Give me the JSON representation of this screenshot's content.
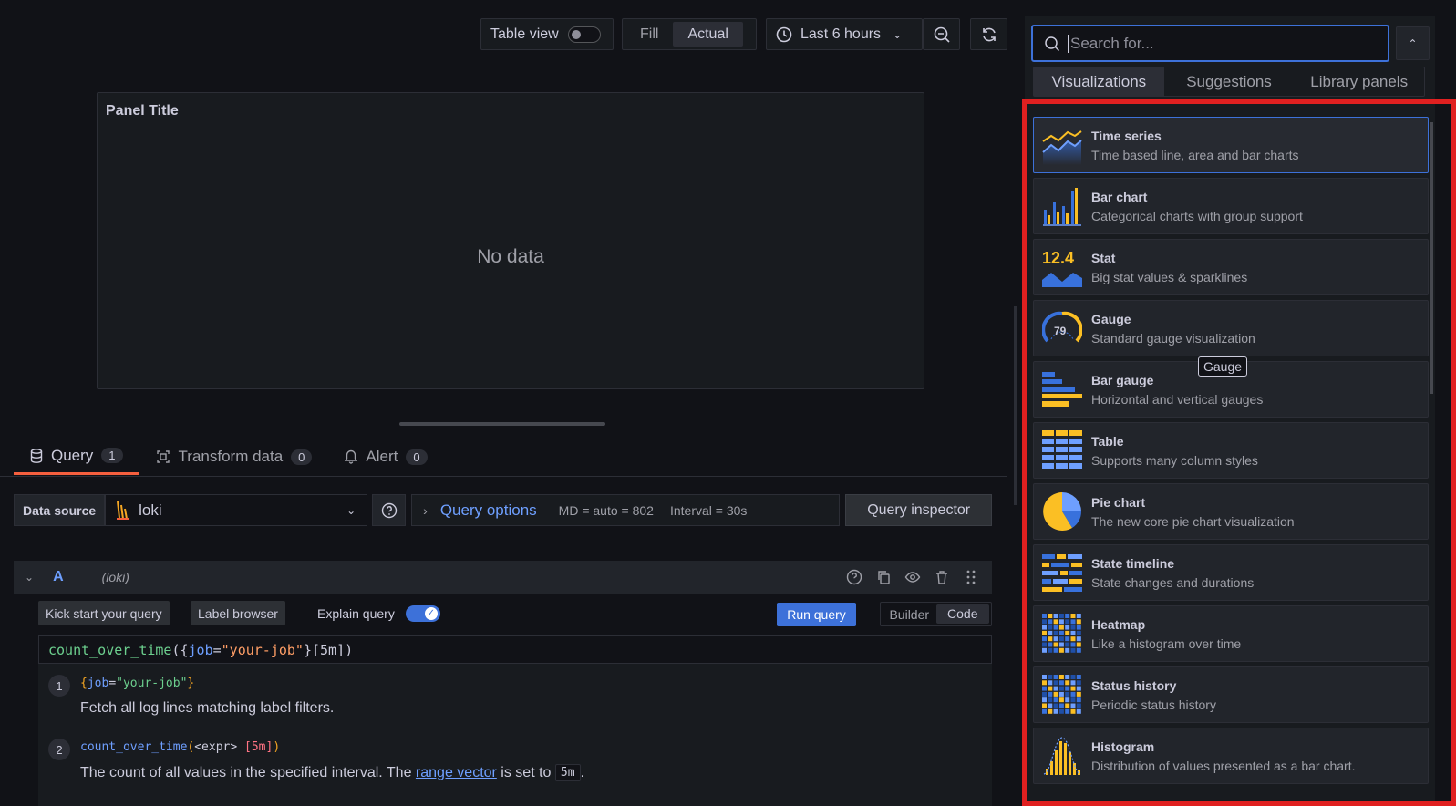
{
  "toolbar": {
    "table_view": "Table view",
    "fill": "Fill",
    "actual": "Actual",
    "time_range": "Last 6 hours"
  },
  "panel": {
    "title": "Panel Title",
    "no_data": "No data"
  },
  "tabs": [
    {
      "label": "Query",
      "count": "1"
    },
    {
      "label": "Transform data",
      "count": "0"
    },
    {
      "label": "Alert",
      "count": "0"
    }
  ],
  "datasource": {
    "label": "Data source",
    "value": "loki",
    "query_options": "Query options",
    "md": "MD = auto = 802",
    "interval": "Interval = 30s",
    "inspector": "Query inspector"
  },
  "query": {
    "ref": "A",
    "ds_hint": "(loki)",
    "kick_start": "Kick start your query",
    "label_browser": "Label browser",
    "explain": "Explain query",
    "run": "Run query",
    "builder": "Builder",
    "code": "Code",
    "expr_fn": "count_over_time",
    "expr_open": "({",
    "expr_key": "job",
    "expr_eq": "=",
    "expr_val": "\"your-job\"",
    "expr_close": "}[5m])",
    "step1_num": "1",
    "step1_code_open": "{",
    "step1_code_key": "job",
    "step1_code_eq": "=",
    "step1_code_val": "\"your-job\"",
    "step1_code_close": "}",
    "step1_desc": "Fetch all log lines matching label filters.",
    "step2_num": "2",
    "step2_fn": "count_over_time",
    "step2_open": "(",
    "step2_arg": "<expr>",
    "step2_range": " [5m]",
    "step2_close": ")",
    "step2_desc_pre": "The count of all values in the specified interval. The ",
    "step2_link": "range vector",
    "step2_desc_mid": " is set to ",
    "step2_chip": "5m",
    "step2_desc_end": "."
  },
  "search": {
    "placeholder": "Search for..."
  },
  "right_tabs": [
    "Visualizations",
    "Suggestions",
    "Library panels"
  ],
  "visualizations": [
    {
      "name": "Time series",
      "desc": "Time based line, area and bar charts",
      "icon": "time-series-icon"
    },
    {
      "name": "Bar chart",
      "desc": "Categorical charts with group support",
      "icon": "bar-chart-icon"
    },
    {
      "name": "Stat",
      "desc": "Big stat values & sparklines",
      "icon": "stat-icon"
    },
    {
      "name": "Gauge",
      "desc": "Standard gauge visualization",
      "icon": "gauge-icon"
    },
    {
      "name": "Bar gauge",
      "desc": "Horizontal and vertical gauges",
      "icon": "bar-gauge-icon"
    },
    {
      "name": "Table",
      "desc": "Supports many column styles",
      "icon": "table-icon"
    },
    {
      "name": "Pie chart",
      "desc": "The new core pie chart visualization",
      "icon": "pie-chart-icon"
    },
    {
      "name": "State timeline",
      "desc": "State changes and durations",
      "icon": "state-timeline-icon"
    },
    {
      "name": "Heatmap",
      "desc": "Like a histogram over time",
      "icon": "heatmap-icon"
    },
    {
      "name": "Status history",
      "desc": "Periodic status history",
      "icon": "status-history-icon"
    },
    {
      "name": "Histogram",
      "desc": "Distribution of values presented as a bar chart.",
      "icon": "histogram-icon"
    }
  ],
  "icon_text": {
    "stat": "12.4",
    "gauge": "79"
  },
  "tooltip": "Gauge",
  "colors": {
    "accent": "#3d71d9",
    "highlight": "#e02020",
    "orange": "#f55f3e",
    "yellow": "#fbbf24",
    "blue": "#3871dc"
  }
}
